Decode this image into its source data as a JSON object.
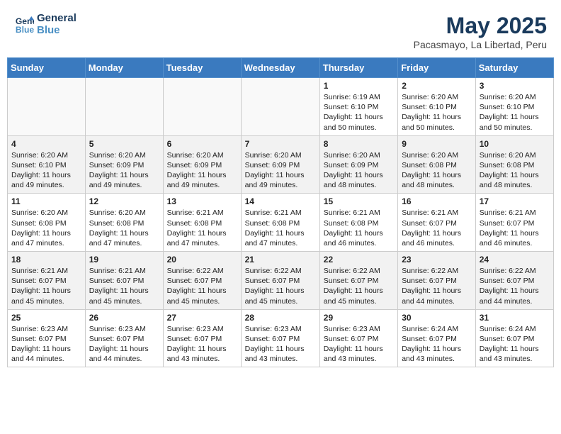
{
  "header": {
    "logo_line1": "General",
    "logo_line2": "Blue",
    "month": "May 2025",
    "location": "Pacasmayo, La Libertad, Peru"
  },
  "weekdays": [
    "Sunday",
    "Monday",
    "Tuesday",
    "Wednesday",
    "Thursday",
    "Friday",
    "Saturday"
  ],
  "weeks": [
    [
      {
        "day": "",
        "info": ""
      },
      {
        "day": "",
        "info": ""
      },
      {
        "day": "",
        "info": ""
      },
      {
        "day": "",
        "info": ""
      },
      {
        "day": "1",
        "info": "Sunrise: 6:19 AM\nSunset: 6:10 PM\nDaylight: 11 hours\nand 50 minutes."
      },
      {
        "day": "2",
        "info": "Sunrise: 6:20 AM\nSunset: 6:10 PM\nDaylight: 11 hours\nand 50 minutes."
      },
      {
        "day": "3",
        "info": "Sunrise: 6:20 AM\nSunset: 6:10 PM\nDaylight: 11 hours\nand 50 minutes."
      }
    ],
    [
      {
        "day": "4",
        "info": "Sunrise: 6:20 AM\nSunset: 6:10 PM\nDaylight: 11 hours\nand 49 minutes."
      },
      {
        "day": "5",
        "info": "Sunrise: 6:20 AM\nSunset: 6:09 PM\nDaylight: 11 hours\nand 49 minutes."
      },
      {
        "day": "6",
        "info": "Sunrise: 6:20 AM\nSunset: 6:09 PM\nDaylight: 11 hours\nand 49 minutes."
      },
      {
        "day": "7",
        "info": "Sunrise: 6:20 AM\nSunset: 6:09 PM\nDaylight: 11 hours\nand 49 minutes."
      },
      {
        "day": "8",
        "info": "Sunrise: 6:20 AM\nSunset: 6:09 PM\nDaylight: 11 hours\nand 48 minutes."
      },
      {
        "day": "9",
        "info": "Sunrise: 6:20 AM\nSunset: 6:08 PM\nDaylight: 11 hours\nand 48 minutes."
      },
      {
        "day": "10",
        "info": "Sunrise: 6:20 AM\nSunset: 6:08 PM\nDaylight: 11 hours\nand 48 minutes."
      }
    ],
    [
      {
        "day": "11",
        "info": "Sunrise: 6:20 AM\nSunset: 6:08 PM\nDaylight: 11 hours\nand 47 minutes."
      },
      {
        "day": "12",
        "info": "Sunrise: 6:20 AM\nSunset: 6:08 PM\nDaylight: 11 hours\nand 47 minutes."
      },
      {
        "day": "13",
        "info": "Sunrise: 6:21 AM\nSunset: 6:08 PM\nDaylight: 11 hours\nand 47 minutes."
      },
      {
        "day": "14",
        "info": "Sunrise: 6:21 AM\nSunset: 6:08 PM\nDaylight: 11 hours\nand 47 minutes."
      },
      {
        "day": "15",
        "info": "Sunrise: 6:21 AM\nSunset: 6:08 PM\nDaylight: 11 hours\nand 46 minutes."
      },
      {
        "day": "16",
        "info": "Sunrise: 6:21 AM\nSunset: 6:07 PM\nDaylight: 11 hours\nand 46 minutes."
      },
      {
        "day": "17",
        "info": "Sunrise: 6:21 AM\nSunset: 6:07 PM\nDaylight: 11 hours\nand 46 minutes."
      }
    ],
    [
      {
        "day": "18",
        "info": "Sunrise: 6:21 AM\nSunset: 6:07 PM\nDaylight: 11 hours\nand 45 minutes."
      },
      {
        "day": "19",
        "info": "Sunrise: 6:21 AM\nSunset: 6:07 PM\nDaylight: 11 hours\nand 45 minutes."
      },
      {
        "day": "20",
        "info": "Sunrise: 6:22 AM\nSunset: 6:07 PM\nDaylight: 11 hours\nand 45 minutes."
      },
      {
        "day": "21",
        "info": "Sunrise: 6:22 AM\nSunset: 6:07 PM\nDaylight: 11 hours\nand 45 minutes."
      },
      {
        "day": "22",
        "info": "Sunrise: 6:22 AM\nSunset: 6:07 PM\nDaylight: 11 hours\nand 45 minutes."
      },
      {
        "day": "23",
        "info": "Sunrise: 6:22 AM\nSunset: 6:07 PM\nDaylight: 11 hours\nand 44 minutes."
      },
      {
        "day": "24",
        "info": "Sunrise: 6:22 AM\nSunset: 6:07 PM\nDaylight: 11 hours\nand 44 minutes."
      }
    ],
    [
      {
        "day": "25",
        "info": "Sunrise: 6:23 AM\nSunset: 6:07 PM\nDaylight: 11 hours\nand 44 minutes."
      },
      {
        "day": "26",
        "info": "Sunrise: 6:23 AM\nSunset: 6:07 PM\nDaylight: 11 hours\nand 44 minutes."
      },
      {
        "day": "27",
        "info": "Sunrise: 6:23 AM\nSunset: 6:07 PM\nDaylight: 11 hours\nand 43 minutes."
      },
      {
        "day": "28",
        "info": "Sunrise: 6:23 AM\nSunset: 6:07 PM\nDaylight: 11 hours\nand 43 minutes."
      },
      {
        "day": "29",
        "info": "Sunrise: 6:23 AM\nSunset: 6:07 PM\nDaylight: 11 hours\nand 43 minutes."
      },
      {
        "day": "30",
        "info": "Sunrise: 6:24 AM\nSunset: 6:07 PM\nDaylight: 11 hours\nand 43 minutes."
      },
      {
        "day": "31",
        "info": "Sunrise: 6:24 AM\nSunset: 6:07 PM\nDaylight: 11 hours\nand 43 minutes."
      }
    ]
  ]
}
